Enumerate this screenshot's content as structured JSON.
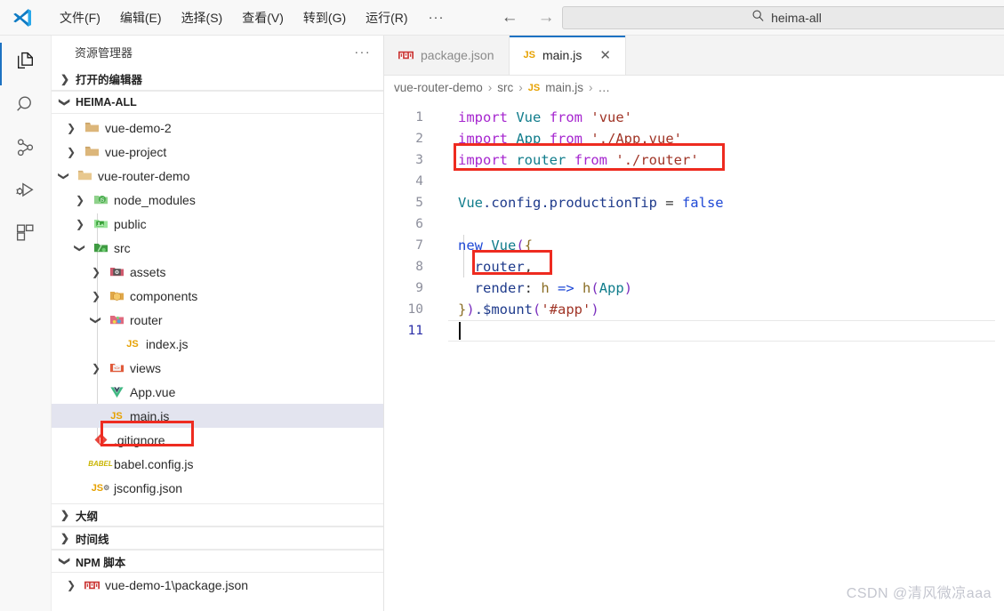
{
  "titlebar": {
    "logo": "vscode-logo",
    "menus": [
      {
        "label": "文件(F)",
        "mnemonic": "F"
      },
      {
        "label": "编辑(E)",
        "mnemonic": "E"
      },
      {
        "label": "选择(S)",
        "mnemonic": "S"
      },
      {
        "label": "查看(V)",
        "mnemonic": "V"
      },
      {
        "label": "转到(G)",
        "mnemonic": "G"
      },
      {
        "label": "运行(R)",
        "mnemonic": "R"
      }
    ],
    "more_label": "···",
    "back_label": "←",
    "forward_label": "→",
    "search": {
      "value": "heima-all",
      "placeholder": "heima-all",
      "icon": "search-icon"
    }
  },
  "activitybar": {
    "items": [
      {
        "name": "explorer",
        "icon": "files-icon",
        "active": true
      },
      {
        "name": "search",
        "icon": "search-icon",
        "active": false
      },
      {
        "name": "source-control",
        "icon": "source-control-icon",
        "active": false
      },
      {
        "name": "run-debug",
        "icon": "run-debug-icon",
        "active": false
      },
      {
        "name": "extensions",
        "icon": "extensions-icon",
        "active": false
      }
    ]
  },
  "sidebar": {
    "title": "资源管理器",
    "more_actions": "···",
    "sections": [
      {
        "label": "打开的编辑器",
        "expanded": false
      },
      {
        "label": "HEIMA-ALL",
        "expanded": true
      },
      {
        "label": "大纲",
        "expanded": false
      },
      {
        "label": "时间线",
        "expanded": false
      },
      {
        "label": "NPM 脚本",
        "expanded": true
      }
    ],
    "tree": [
      {
        "label": "vue-demo-2",
        "icon": "folder-icon",
        "indent": 1,
        "twisty": "collapsed",
        "selected": false
      },
      {
        "label": "vue-project",
        "icon": "folder-icon",
        "indent": 1,
        "twisty": "collapsed",
        "selected": false
      },
      {
        "label": "vue-router-demo",
        "icon": "folder-icon",
        "indent": 1,
        "twisty": "expanded",
        "selected": false
      },
      {
        "label": "node_modules",
        "icon": "folder-node-icon",
        "indent": 2,
        "twisty": "collapsed",
        "selected": false
      },
      {
        "label": "public",
        "icon": "folder-public-icon",
        "indent": 2,
        "twisty": "collapsed",
        "selected": false
      },
      {
        "label": "src",
        "icon": "folder-src-icon",
        "indent": 2,
        "twisty": "expanded",
        "selected": false
      },
      {
        "label": "assets",
        "icon": "folder-assets-icon",
        "indent": 3,
        "twisty": "collapsed",
        "selected": false
      },
      {
        "label": "components",
        "icon": "folder-components-icon",
        "indent": 3,
        "twisty": "collapsed",
        "selected": false
      },
      {
        "label": "router",
        "icon": "folder-router-icon",
        "indent": 3,
        "twisty": "expanded",
        "selected": false
      },
      {
        "label": "index.js",
        "icon": "js-file-icon",
        "indent": 4,
        "twisty": "none",
        "selected": false
      },
      {
        "label": "views",
        "icon": "folder-views-icon",
        "indent": 3,
        "twisty": "collapsed",
        "selected": false
      },
      {
        "label": "App.vue",
        "icon": "vue-file-icon",
        "indent": 3,
        "twisty": "none",
        "selected": false
      },
      {
        "label": "main.js",
        "icon": "js-file-icon",
        "indent": 3,
        "twisty": "none",
        "selected": true
      },
      {
        "label": ".gitignore",
        "icon": "git-file-icon",
        "indent": 2,
        "twisty": "none",
        "selected": false
      },
      {
        "label": "babel.config.js",
        "icon": "babel-file-icon",
        "indent": 2,
        "twisty": "none",
        "selected": false
      },
      {
        "label": "jsconfig.json",
        "icon": "jsconfig-file-icon",
        "indent": 2,
        "twisty": "none",
        "selected": false
      }
    ],
    "npm_scripts": [
      {
        "label": "vue-demo-1\\package.json",
        "icon": "npm-icon",
        "twisty": "collapsed"
      }
    ]
  },
  "editor": {
    "tabs": [
      {
        "label": "package.json",
        "icon": "npm-icon",
        "active": false,
        "closable": false
      },
      {
        "label": "main.js",
        "icon": "js-file-icon",
        "active": true,
        "closable": true,
        "close_label": "✕"
      }
    ],
    "breadcrumb": [
      {
        "label": "vue-router-demo",
        "icon": ""
      },
      {
        "label": "src",
        "icon": ""
      },
      {
        "label": "main.js",
        "icon": "js-file-icon"
      },
      {
        "label": "…",
        "icon": ""
      }
    ],
    "breadcrumb_sep": "›",
    "lines": [
      {
        "n": "1",
        "tokens": [
          {
            "t": "import",
            "c": "kw"
          },
          {
            "t": " ",
            "c": "op"
          },
          {
            "t": "Vue",
            "c": "teal"
          },
          {
            "t": " ",
            "c": "op"
          },
          {
            "t": "from",
            "c": "kw"
          },
          {
            "t": " ",
            "c": "op"
          },
          {
            "t": "'vue'",
            "c": "str"
          }
        ]
      },
      {
        "n": "2",
        "tokens": [
          {
            "t": "import",
            "c": "kw"
          },
          {
            "t": " ",
            "c": "op"
          },
          {
            "t": "App",
            "c": "teal"
          },
          {
            "t": " ",
            "c": "op"
          },
          {
            "t": "from",
            "c": "kw"
          },
          {
            "t": " ",
            "c": "op"
          },
          {
            "t": "'./App.vue'",
            "c": "str"
          }
        ]
      },
      {
        "n": "3",
        "tokens": [
          {
            "t": "import",
            "c": "kw"
          },
          {
            "t": " ",
            "c": "op"
          },
          {
            "t": "router",
            "c": "teal"
          },
          {
            "t": " ",
            "c": "op"
          },
          {
            "t": "from",
            "c": "kw"
          },
          {
            "t": " ",
            "c": "op"
          },
          {
            "t": "'./router'",
            "c": "str"
          }
        ]
      },
      {
        "n": "4",
        "tokens": []
      },
      {
        "n": "5",
        "tokens": [
          {
            "t": "Vue",
            "c": "teal"
          },
          {
            "t": ".config.productionTip",
            "c": "id"
          },
          {
            "t": " = ",
            "c": "op"
          },
          {
            "t": "false",
            "c": "blue"
          }
        ]
      },
      {
        "n": "6",
        "tokens": []
      },
      {
        "n": "7",
        "tokens": [
          {
            "t": "new",
            "c": "blue"
          },
          {
            "t": " ",
            "c": "op"
          },
          {
            "t": "Vue",
            "c": "teal"
          },
          {
            "t": "(",
            "c": "prn"
          },
          {
            "t": "{",
            "c": "brn"
          }
        ]
      },
      {
        "n": "8",
        "tokens": [
          {
            "t": "  ",
            "c": "op"
          },
          {
            "t": "router",
            "c": "id"
          },
          {
            "t": ",",
            "c": "op"
          }
        ]
      },
      {
        "n": "9",
        "tokens": [
          {
            "t": "  ",
            "c": "op"
          },
          {
            "t": "render",
            "c": "id"
          },
          {
            "t": ": ",
            "c": "op"
          },
          {
            "t": "h",
            "c": "brn"
          },
          {
            "t": " => ",
            "c": "blue"
          },
          {
            "t": "h",
            "c": "brn"
          },
          {
            "t": "(",
            "c": "prn"
          },
          {
            "t": "App",
            "c": "teal"
          },
          {
            "t": ")",
            "c": "prn"
          }
        ]
      },
      {
        "n": "10",
        "tokens": [
          {
            "t": "}",
            "c": "brn"
          },
          {
            "t": ")",
            "c": "prn"
          },
          {
            "t": ".$mount",
            "c": "id"
          },
          {
            "t": "(",
            "c": "prn"
          },
          {
            "t": "'#app'",
            "c": "str"
          },
          {
            "t": ")",
            "c": "prn"
          }
        ]
      },
      {
        "n": "11",
        "tokens": [],
        "active": true
      }
    ]
  },
  "annotations": [
    {
      "name": "import-router-highlight"
    },
    {
      "name": "router-option-highlight"
    },
    {
      "name": "main-js-file-highlight"
    }
  ],
  "watermark": "CSDN @清风微凉aaa"
}
